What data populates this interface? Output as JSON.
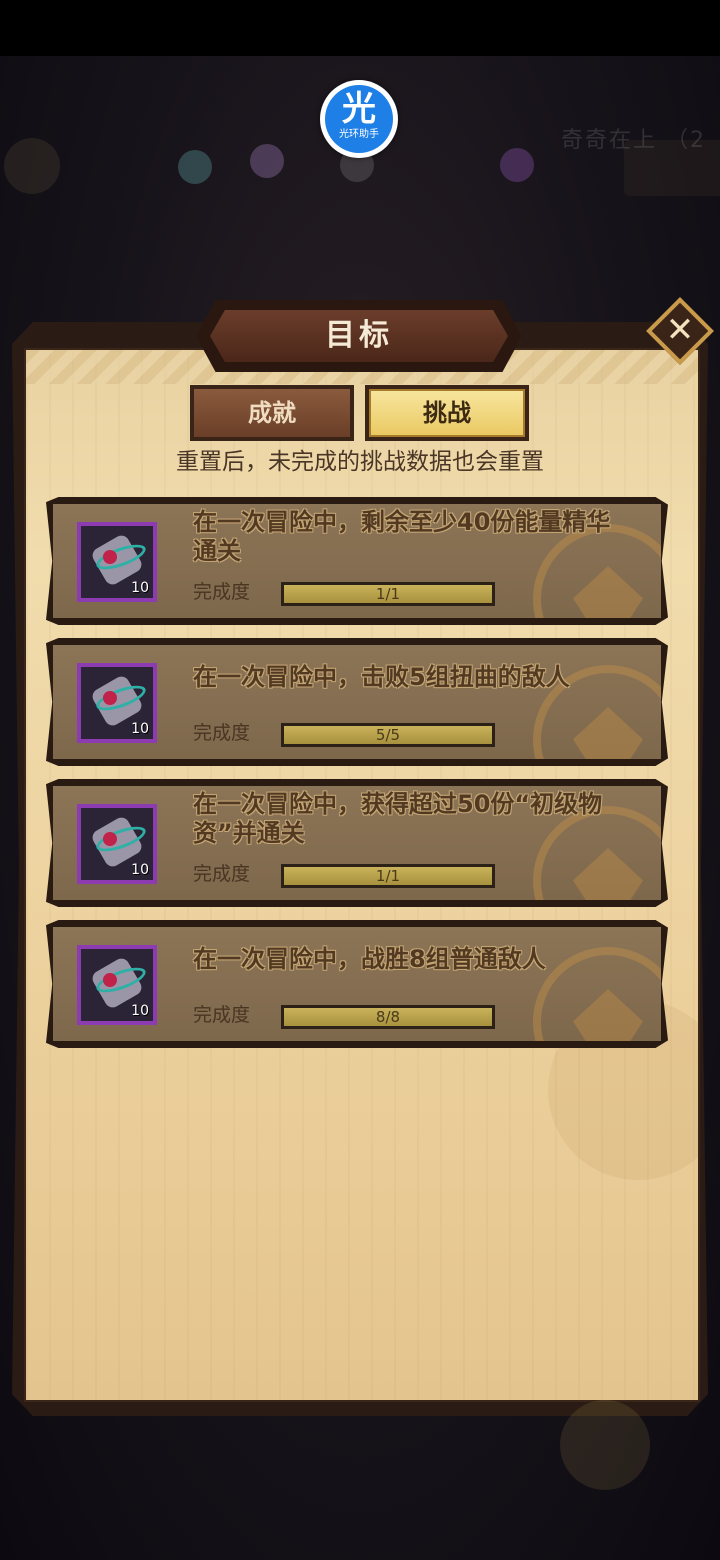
{
  "watermark": {
    "glyph": "光",
    "label": "光环助手"
  },
  "background_hud": {
    "corner_text": "奇奇在上 （2"
  },
  "dialog": {
    "title": "目标",
    "tabs": [
      {
        "label": "成就",
        "selected": false
      },
      {
        "label": "挑战",
        "selected": true
      }
    ],
    "notice": "重置后，未完成的挑战数据也会重置"
  },
  "challenges": [
    {
      "title": "在一次冒险中，剩余至少40份能量精华通关",
      "progress_label": "完成度",
      "progress_text": "1/1",
      "progress_fraction": 1.0,
      "reward_count": "10"
    },
    {
      "title": "在一次冒险中，击败5组扭曲的敌人",
      "progress_label": "完成度",
      "progress_text": "5/5",
      "progress_fraction": 1.0,
      "reward_count": "10"
    },
    {
      "title": "在一次冒险中，获得超过50份“初级物资”并通关",
      "progress_label": "完成度",
      "progress_text": "1/1",
      "progress_fraction": 1.0,
      "reward_count": "10"
    },
    {
      "title": "在一次冒险中，战胜8组普通敌人",
      "progress_label": "完成度",
      "progress_text": "8/8",
      "progress_fraction": 1.0,
      "reward_count": "10"
    }
  ],
  "icons": {
    "reward": "scroll-with-ribbon-icon",
    "close": "close-icon",
    "card_emblem": "crest-emblem-icon"
  },
  "colors": {
    "parchment": "#eed7a6",
    "card": "#8c7456",
    "progress_fill": "#c9b25a",
    "reward_frame": "#8c3bb0",
    "selected_tab": "#f4dd8a"
  }
}
